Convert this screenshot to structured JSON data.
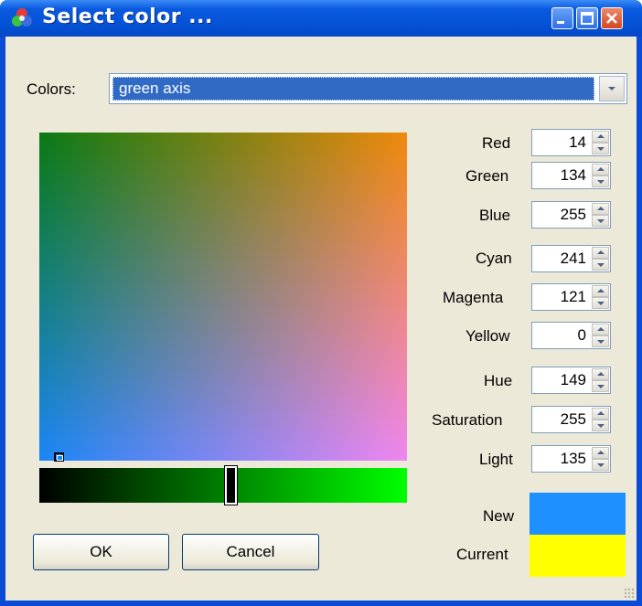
{
  "window": {
    "title": "Select color ...",
    "controls": [
      "minimize-icon",
      "maximize-icon",
      "close-icon"
    ]
  },
  "colors_combo": {
    "label": "Colors:",
    "value": "green axis"
  },
  "palette": {
    "mode": "green axis",
    "corner_colors": {
      "top_left": "#0a7a14",
      "top_right": "#ef8a0c",
      "bottom_left": "#1a86f6",
      "bottom_right": "#ef86f0"
    }
  },
  "slider": {
    "from_color": "#000000",
    "to_color": "#00ff00",
    "value": 134,
    "max": 255
  },
  "fields": {
    "red": {
      "label": "Red",
      "value": "14"
    },
    "green": {
      "label": "Green",
      "value": "134"
    },
    "blue": {
      "label": "Blue",
      "value": "255"
    },
    "cyan": {
      "label": "Cyan",
      "value": "241"
    },
    "magenta": {
      "label": "Magenta",
      "value": "121"
    },
    "yellow": {
      "label": "Yellow",
      "value": "0"
    },
    "hue": {
      "label": "Hue",
      "value": "149"
    },
    "saturation": {
      "label": "Saturation",
      "value": "255"
    },
    "light": {
      "label": "Light",
      "value": "135"
    }
  },
  "preview": {
    "new_label": "New",
    "new_color": "#1e90ff",
    "current_label": "Current",
    "current_color": "#ffff00"
  },
  "buttons": {
    "ok": "OK",
    "cancel": "Cancel"
  }
}
